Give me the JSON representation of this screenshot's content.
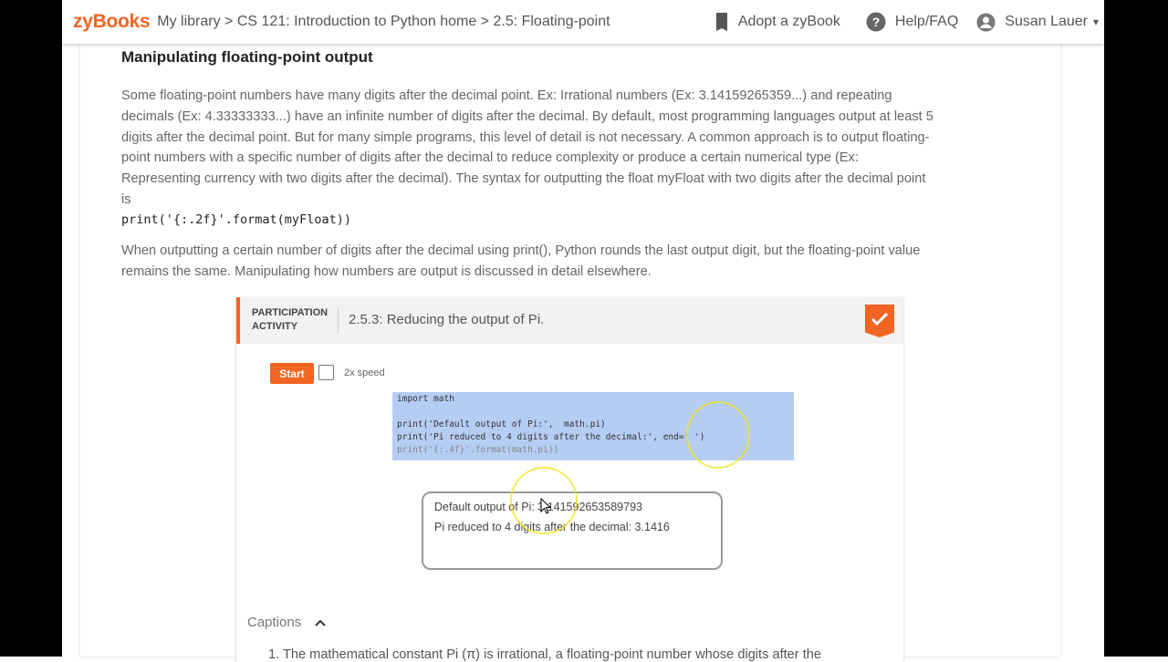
{
  "topbar": {
    "logo": "zyBooks",
    "breadcrumb": [
      "My library",
      "CS 121: Introduction to Python home",
      "2.5: Floating-point"
    ],
    "breadcrumb_sep": " > ",
    "adopt_label": "Adopt a zyBook",
    "help_label": "Help/FAQ",
    "user_name": "Susan Lauer"
  },
  "content": {
    "section_title": "Manipulating floating-point output",
    "paragraph1_lines": [
      "Some floating-point numbers have many digits after the decimal point. Ex: Irrational numbers (Ex: 3.14159265359...) and repeating",
      "decimals (Ex: 4.33333333...) have an infinite number of digits after the decimal. By default, most programming languages output at least 5",
      "digits after the decimal point. But for many simple programs, this level of detail is not necessary. A common approach is to output floating-",
      "point numbers with a specific number of digits after the decimal to reduce complexity or produce a certain numerical type (Ex:",
      "Representing currency with two digits after the decimal). The syntax for outputting the float myFloat with two digits after the decimal point",
      "is"
    ],
    "code_example": "print('{:.2f}'.format(myFloat))",
    "paragraph2_lines": [
      "When outputting a certain number of digits after the decimal using print(), Python rounds the last output digit, but the floating-point value",
      "remains the same. Manipulating how numbers are output is discussed in detail elsewhere."
    ]
  },
  "activity": {
    "label_line1": "PARTICIPATION",
    "label_line2": "ACTIVITY",
    "title": "2.5.3: Reducing the output of Pi.",
    "start_label": "Start",
    "speed_label": "2x speed",
    "code_lines": [
      "import math",
      "",
      "print('Default output of Pi:',  math.pi)",
      "print('Pi reduced to 4 digits after the decimal:', end=' ')",
      "print('{:.4f}'.format(math.pi))"
    ],
    "output_lines": [
      "Default output of Pi: 3.141592653589793",
      "Pi reduced to 4 digits after the decimal: 3.1416"
    ],
    "captions_label": "Captions",
    "caption_1": "1. The mathematical constant Pi (π) is irrational, a floating-point number whose digits after the"
  },
  "colors": {
    "brand": "#f26522",
    "code_highlight": "#b5cdf2"
  }
}
